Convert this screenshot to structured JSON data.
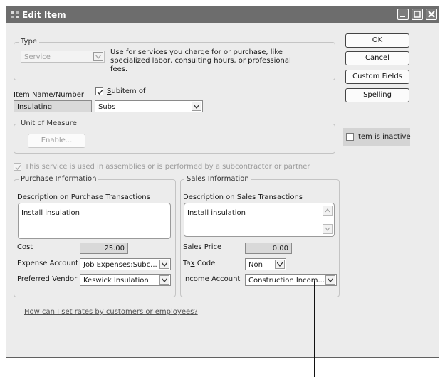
{
  "window": {
    "title": "Edit Item"
  },
  "type_group": {
    "legend": "Type",
    "type_value": "Service",
    "description": [
      "Use for services you charge for or purchase, like",
      "specialized labor, consulting hours, or professional",
      "fees."
    ]
  },
  "item": {
    "name_label": "Item Name/Number",
    "name_value": "Insulating",
    "subitem_label": "Subitem of",
    "subitem_checked": true,
    "subitem_value": "Subs"
  },
  "unit_of_measure": {
    "legend": "Unit of Measure",
    "enable_label": "Enable..."
  },
  "assembly_checkbox": {
    "label": "This service is used in assemblies or is performed by a subcontractor or partner",
    "checked": true
  },
  "purchase": {
    "legend": "Purchase Information",
    "desc_label": "Description on Purchase Transactions",
    "desc_value": "Install insulation",
    "cost_label": "Cost",
    "cost_value": "25.00",
    "expense_label": "Expense Account",
    "expense_value": "Job Expenses:Subc...",
    "vendor_label": "Preferred Vendor",
    "vendor_value": "Keswick Insulation"
  },
  "sales": {
    "legend": "Sales Information",
    "desc_label": "Description on Sales Transactions",
    "desc_value": "Install insulation",
    "price_label": "Sales Price",
    "price_value": "0.00",
    "taxcode_label": "Tax Code",
    "taxcode_value": "Non",
    "income_label": "Income Account",
    "income_value": "Construction Incom..."
  },
  "buttons": {
    "ok": "OK",
    "cancel": "Cancel",
    "custom_fields": "Custom Fields",
    "spelling": "Spelling"
  },
  "inactive": {
    "label": "Item is inactive",
    "checked": false
  },
  "help_link": "How can I set rates by customers or employees?"
}
